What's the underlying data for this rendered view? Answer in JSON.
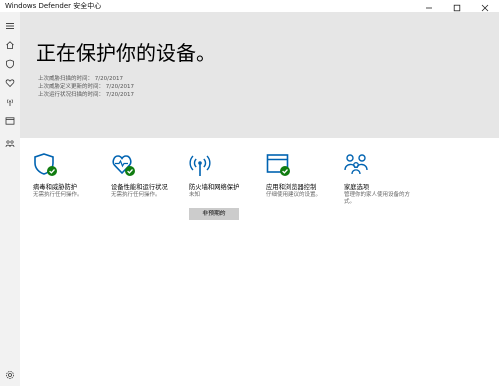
{
  "window": {
    "title": "Windows Defender 安全中心",
    "minimize_icon": "minimize-icon",
    "maximize_icon": "maximize-icon",
    "close_icon": "close-icon"
  },
  "sidebar": {
    "items": [
      {
        "id": "menu",
        "icon": "hamburger-icon"
      },
      {
        "id": "home",
        "icon": "home-icon"
      },
      {
        "id": "virus",
        "icon": "shield-icon"
      },
      {
        "id": "health",
        "icon": "heart-icon"
      },
      {
        "id": "firewall",
        "icon": "antenna-icon"
      },
      {
        "id": "app",
        "icon": "browser-icon"
      },
      {
        "id": "family",
        "icon": "family-icon"
      }
    ],
    "settings_icon": "gear-icon"
  },
  "hero": {
    "title": "正在保护你的设备。",
    "lines": [
      "上次威胁扫描的时间： 7/20/2017",
      "上次威胁定义更新的时间： 7/20/2017",
      "上次运行状况扫描的时间： 7/20/2017"
    ]
  },
  "tiles": [
    {
      "title": "病毒和威胁防护",
      "status": "无需执行任何操作。",
      "icon": "shield-check-icon",
      "ok": true
    },
    {
      "title": "设备性能和运行状况",
      "status": "无需执行任何操作。",
      "icon": "heart-check-icon",
      "ok": true
    },
    {
      "title": "防火墙和网络保护",
      "status": "未知",
      "icon": "antenna-icon",
      "ok": false
    },
    {
      "title": "应用和浏览器控制",
      "status": "仔细使用建议的设置。",
      "icon": "browser-check-icon",
      "ok": true
    },
    {
      "title": "家庭选项",
      "status": "管理你的家人使用设备的方式。",
      "icon": "family-icon",
      "ok": false
    }
  ],
  "firewall_button": {
    "label": "非预期的"
  },
  "colors": {
    "accent": "#0063b1",
    "ok_green": "#107c10",
    "sidebar_bg": "#f2f2f2",
    "hero_bg": "#e6e6e6"
  }
}
